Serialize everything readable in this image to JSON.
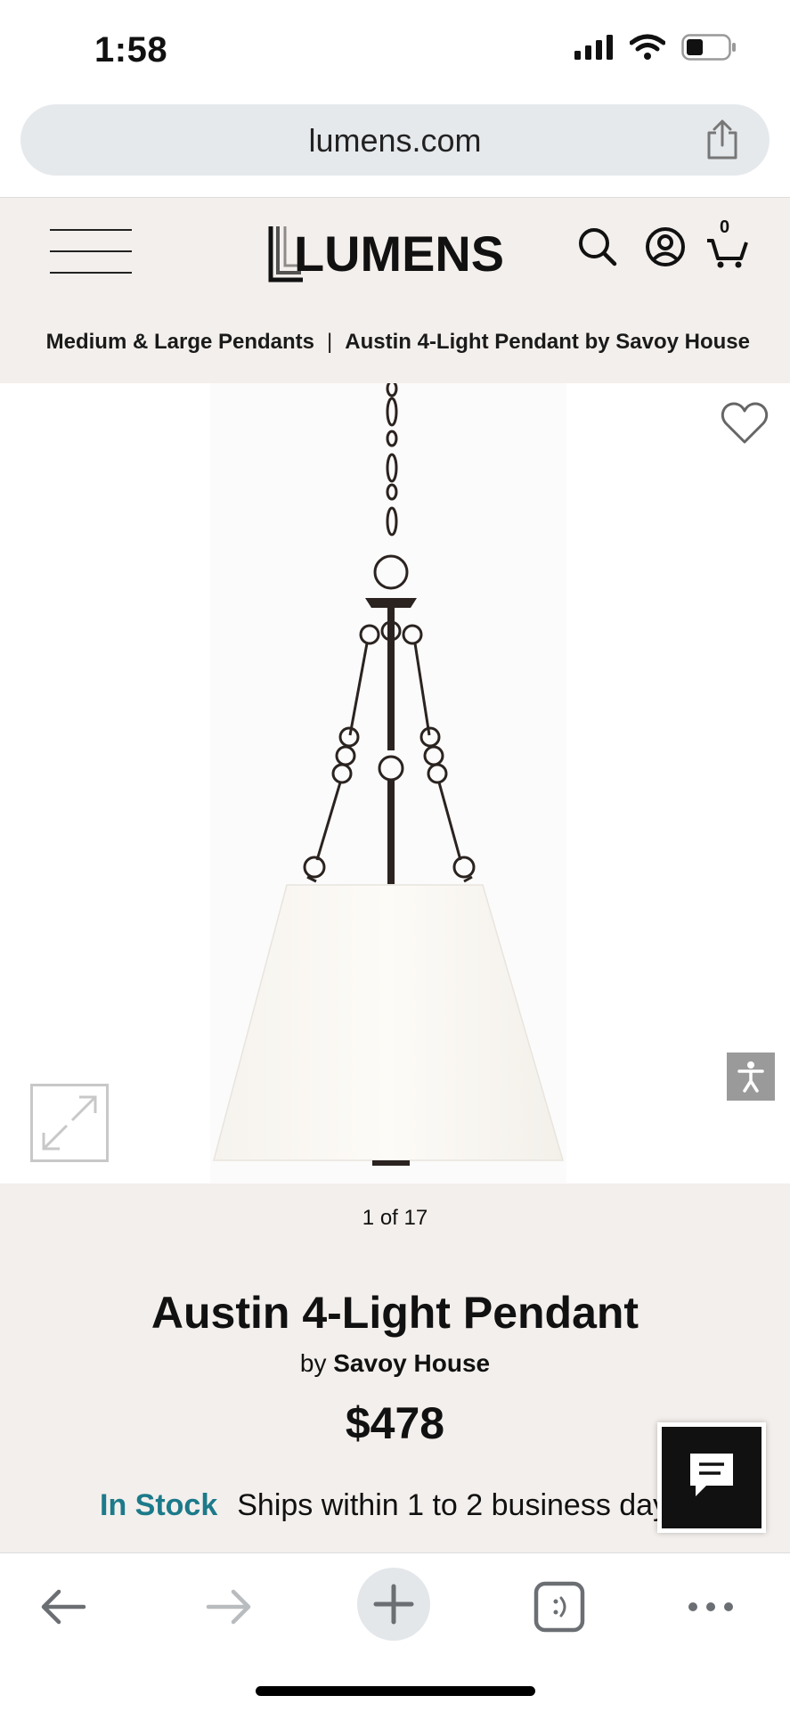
{
  "status_bar": {
    "time": "1:58"
  },
  "browser": {
    "url": "lumens.com"
  },
  "site": {
    "logo_text": "LUMENS",
    "cart_count": "0",
    "breadcrumb": [
      "Medium & Large Pendants",
      "|",
      "Austin 4-Light Pendant by Savoy House"
    ]
  },
  "gallery": {
    "counter": "1 of 17"
  },
  "product": {
    "title": "Austin 4-Light Pendant",
    "by_prefix": "by",
    "brand": "Savoy House",
    "price": "$478",
    "stock_status": "In Stock",
    "shipping": "Ships within 1 to 2 business day"
  },
  "colors": {
    "header_bg": "#f3efec",
    "stock_accent": "#1c7a8a"
  },
  "icons": [
    "signal-icon",
    "wifi-icon",
    "battery-icon",
    "share-icon",
    "menu-icon",
    "search-icon",
    "account-icon",
    "cart-icon",
    "heart-icon",
    "expand-icon",
    "accessibility-icon",
    "chat-icon",
    "back-icon",
    "forward-icon",
    "plus-icon",
    "tabs-icon",
    "more-icon"
  ]
}
